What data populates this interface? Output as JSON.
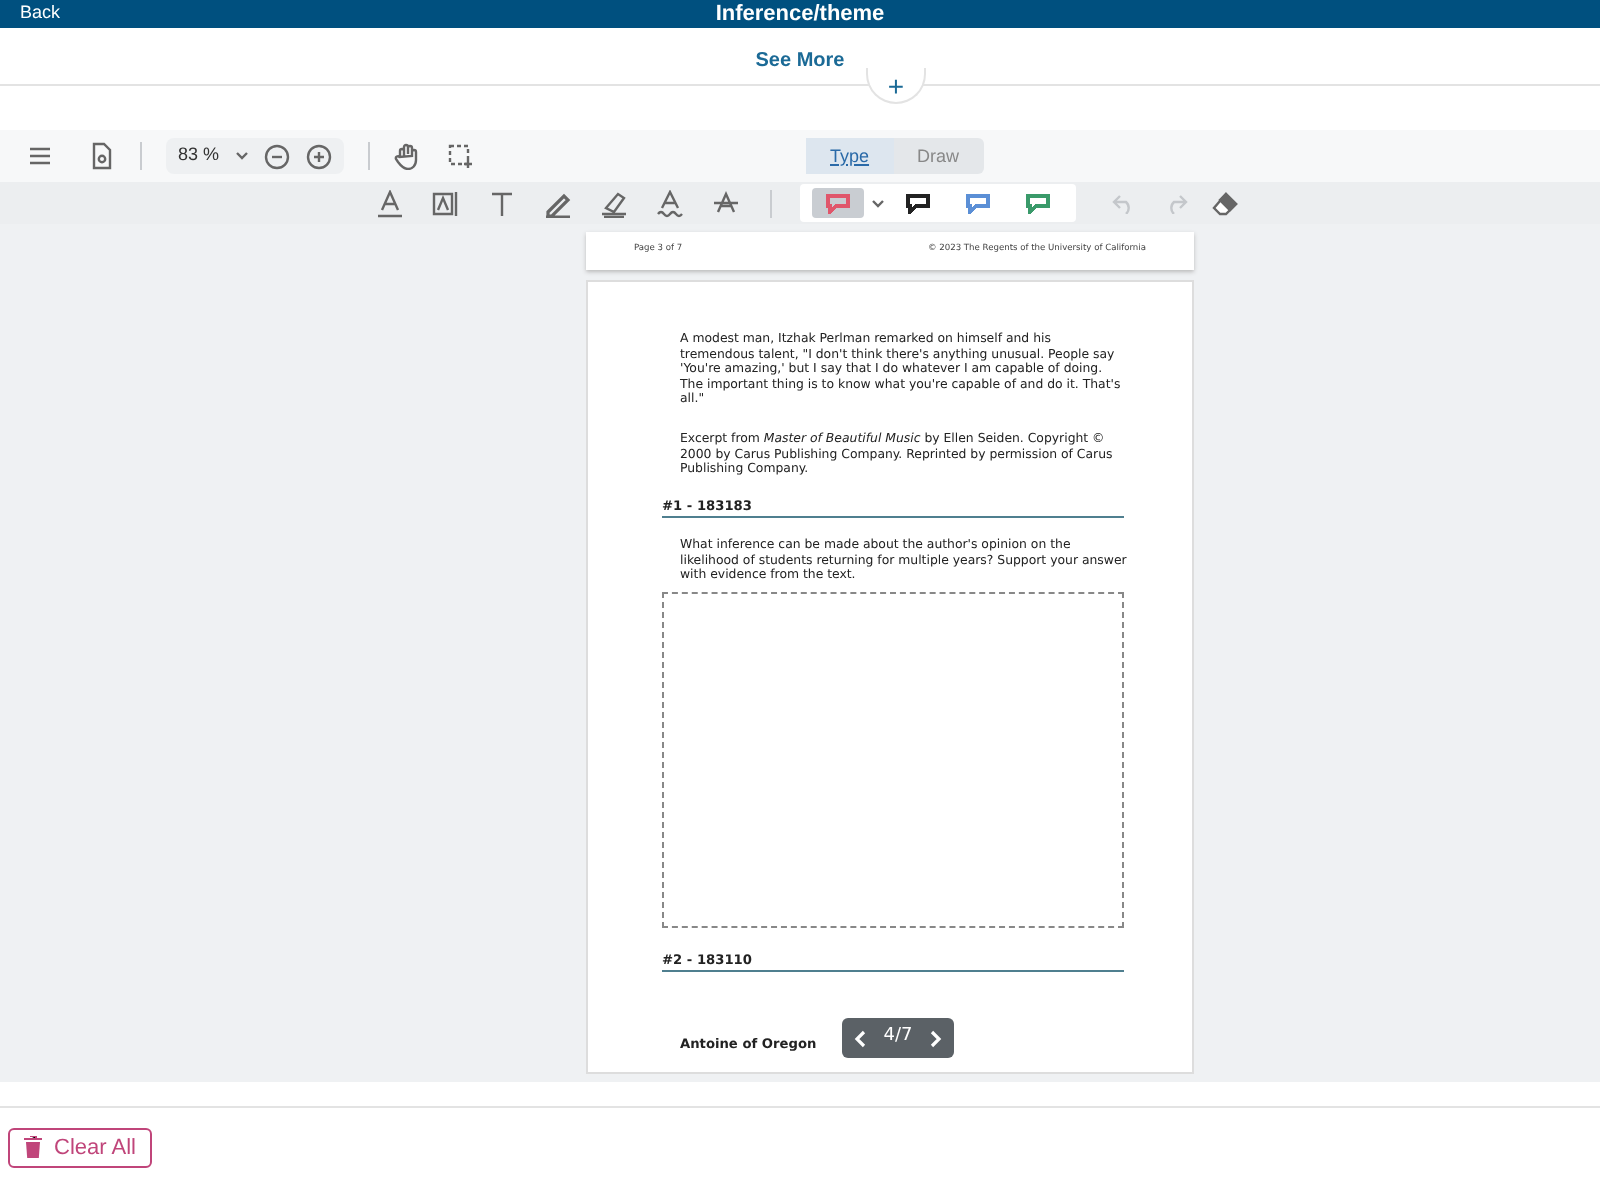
{
  "header": {
    "back_label": "Back",
    "title": "Inference/theme"
  },
  "see_more": {
    "label": "See More",
    "add_label": "+"
  },
  "toolbar": {
    "zoom": "83 %",
    "modes": [
      {
        "label": "Type",
        "selected": true
      },
      {
        "label": "Draw",
        "selected": false
      }
    ]
  },
  "annotation_colors": [
    {
      "color": "#e0566b",
      "selected": true
    },
    {
      "color": "#222222",
      "selected": false
    },
    {
      "color": "#5b8fd6",
      "selected": false
    },
    {
      "color": "#3a9a6a",
      "selected": false
    }
  ],
  "history": {
    "undo_disabled": true,
    "redo_disabled": true
  },
  "document": {
    "page_label": "Page 3 of 7",
    "copyright": "© 2023 The Regents of the University of California",
    "passage": [
      "A modest man, Itzhak Perlman remarked on himself and his tremendous talent, \"I don't think there's anything unusual. People say 'You're amazing,' but I say that I do whatever I am capable of doing. The important thing is to know what you're capable of and do it. That's all.\"",
      "Excerpt from *Master of Beautiful Music* by Ellen Seiden. Copyright © 2000 by Carus Publishing Company. Reprinted by permission of Carus Publishing Company."
    ],
    "questions": [
      {
        "number": "#1 - 183183",
        "prompt": "What inference can be made about the author's opinion on the likelihood of students returning for multiple years? Support your answer with evidence from the text."
      },
      {
        "number": "#2 - 183110"
      }
    ],
    "student": "Antoine of Oregon",
    "pager": "4/7"
  },
  "clear_all": "Clear All"
}
